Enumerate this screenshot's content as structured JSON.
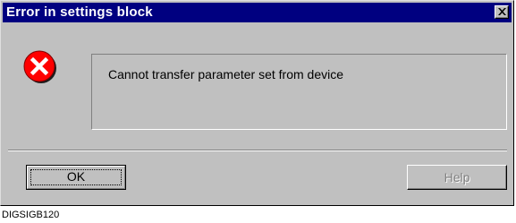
{
  "dialog": {
    "title": "Error in settings block",
    "message": "Cannot transfer parameter set from device",
    "buttons": {
      "ok_label": "OK",
      "help_label": "Help"
    },
    "icons": {
      "close": "close-icon",
      "error": "error-icon"
    }
  },
  "caption": "DIGSIGB120",
  "colors": {
    "titlebar": "#000080",
    "face": "#c0c0c0",
    "error_red": "#ff0000"
  }
}
